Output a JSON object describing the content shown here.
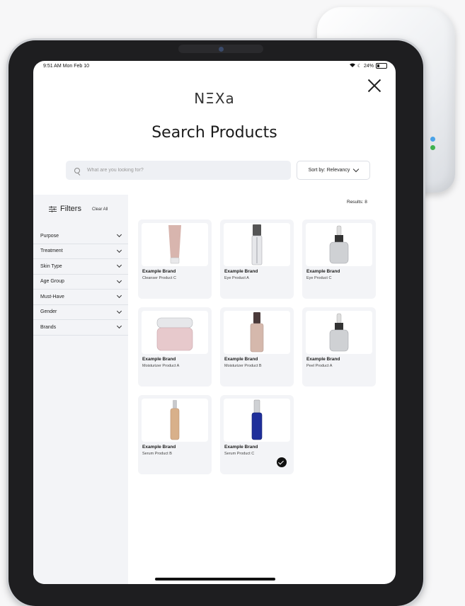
{
  "status_bar": {
    "time": "9:51 AM  Mon Feb 10",
    "battery": "24%"
  },
  "logo": "NΞXa",
  "title": "Search Products",
  "search": {
    "placeholder": "What are you looking for?"
  },
  "sort": {
    "label": "Sort by: Relevancy"
  },
  "filters": {
    "title": "Filters",
    "clear_all": "Clear All",
    "items": [
      "Purpose",
      "Treatment",
      "Skin Type",
      "Age Group",
      "Must-Have",
      "Gender",
      "Brands"
    ]
  },
  "results": {
    "label": "Results: 8"
  },
  "products": [
    {
      "brand": "Example Brand",
      "name": "Cleanser Product C",
      "selected": false
    },
    {
      "brand": "Example Brand",
      "name": "Eye Product A",
      "selected": false
    },
    {
      "brand": "Example Brand",
      "name": "Eye Product C",
      "selected": false
    },
    {
      "brand": "Example Brand",
      "name": "Moisturizer Product A",
      "selected": false
    },
    {
      "brand": "Example Brand",
      "name": "Moisturizer Product B",
      "selected": false
    },
    {
      "brand": "Example Brand",
      "name": "Peel Product A",
      "selected": false
    },
    {
      "brand": "Example Brand",
      "name": "Serum Product B",
      "selected": false
    },
    {
      "brand": "Example Brand",
      "name": "Serum Product C",
      "selected": true
    }
  ]
}
